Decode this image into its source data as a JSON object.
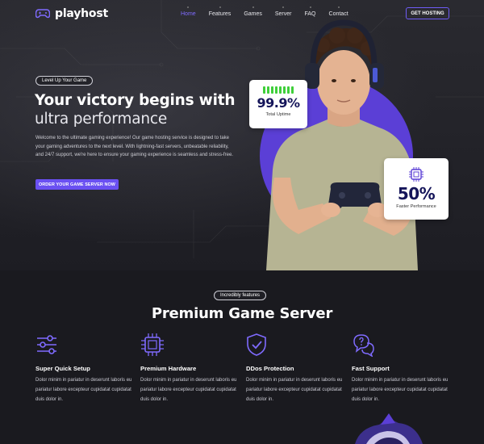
{
  "brand": {
    "name": "playhost",
    "icon": "gamepad-icon"
  },
  "nav": {
    "items": [
      "Home",
      "Features",
      "Games",
      "Server",
      "FAQ",
      "Contact"
    ],
    "active": "Home",
    "cta": "GET HOSTING"
  },
  "hero": {
    "tag": "Level Up Your Game",
    "title_line1": "Your victory begins with",
    "title_line2": "ultra performance",
    "description": "Welcome to the ultimate gaming experience! Our game hosting service is designed to take your gaming adventures to the next level. With lightning-fast servers, unbeatable reliability, and 24/7 support, we're here to ensure your gaming experience is seamless and stress-free.",
    "button": "ORDER YOUR GAME SERVER NOW",
    "stats": {
      "uptime": {
        "value": "99.9%",
        "label": "Total Uptime"
      },
      "performance": {
        "value": "50%",
        "label": "Faster Performance",
        "icon": "chip-icon"
      }
    }
  },
  "features": {
    "tag": "Incredibly features",
    "title": "Premium Game Server",
    "items": [
      {
        "name": "Super Quick Setup",
        "icon": "sliders-icon",
        "desc": "Dolor minim in pariatur in deserunt laboris eu pariatur labore excepteur cupidatat cupidatat duis dolor in."
      },
      {
        "name": "Premium Hardware",
        "icon": "chip-icon",
        "desc": "Dolor minim in pariatur in deserunt laboris eu pariatur labore excepteur cupidatat cupidatat duis dolor in."
      },
      {
        "name": "DDos Protection",
        "icon": "shield-check-icon",
        "desc": "Dolor minim in pariatur in deserunt laboris eu pariatur labore excepteur cupidatat cupidatat duis dolor in."
      },
      {
        "name": "Fast Support",
        "icon": "support-chat-icon",
        "desc": "Dolor minim in pariatur in deserunt laboris eu pariatur labore excepteur cupidatat cupidatat duis dolor in."
      }
    ]
  },
  "colors": {
    "accent": "#6a50f2",
    "accent_light": "#7f6bff",
    "uptime_green": "#3fcf3a",
    "background": "#1b1b21",
    "stat_text": "#15155a"
  }
}
